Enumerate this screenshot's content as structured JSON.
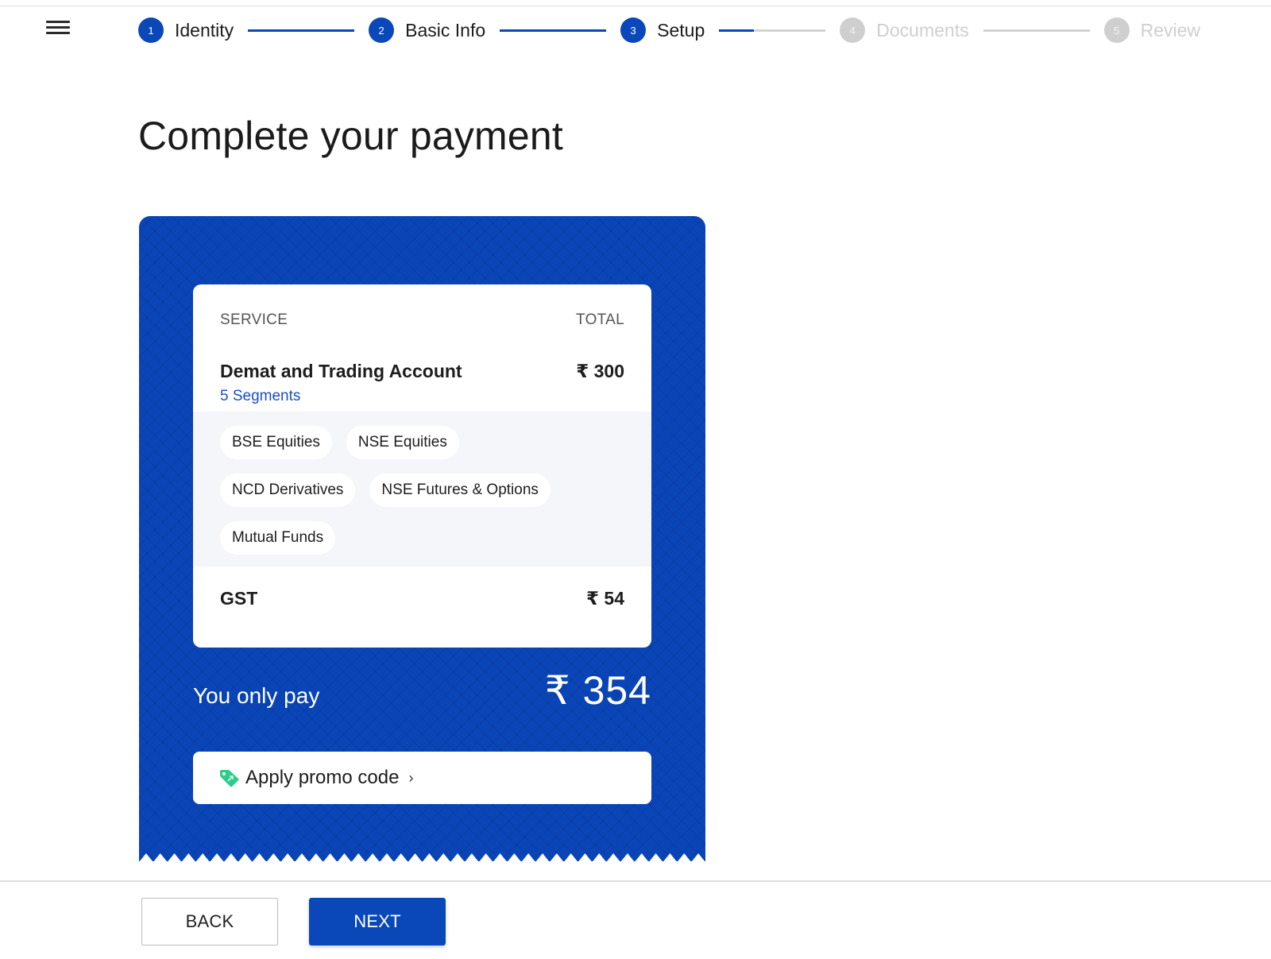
{
  "header": {
    "menu_icon": "hamburger-icon",
    "steps": [
      {
        "number": "1",
        "label": "Identity",
        "state": "complete"
      },
      {
        "number": "2",
        "label": "Basic Info",
        "state": "complete"
      },
      {
        "number": "3",
        "label": "Setup",
        "state": "current"
      },
      {
        "number": "4",
        "label": "Documents",
        "state": "upcoming"
      },
      {
        "number": "5",
        "label": "Review",
        "state": "upcoming"
      }
    ],
    "connector_progress": [
      1,
      1,
      0.33,
      0
    ],
    "accent_color": "#0a47b8",
    "inactive_color": "#cfcfcf"
  },
  "page": {
    "title": "Complete your payment"
  },
  "receipt": {
    "background_color": "#0a45b8",
    "columns": {
      "service": "SERVICE",
      "total": "TOTAL"
    },
    "service": {
      "name": "Demat and Trading Account",
      "price": "₹ 300",
      "segments_link": "5 Segments",
      "segments": [
        "BSE Equities",
        "NSE Equities",
        "NCD Derivatives",
        "NSE Futures & Options",
        "Mutual Funds"
      ]
    },
    "gst": {
      "label": "GST",
      "amount": "₹ 54"
    },
    "total": {
      "label": "You only pay",
      "amount": "₹ 354"
    },
    "promo": {
      "icon": "tag-icon",
      "label": "Apply promo code",
      "chevron": "›",
      "icon_color": "#2ecc8a"
    }
  },
  "footer": {
    "back_label": "BACK",
    "next_label": "NEXT"
  }
}
